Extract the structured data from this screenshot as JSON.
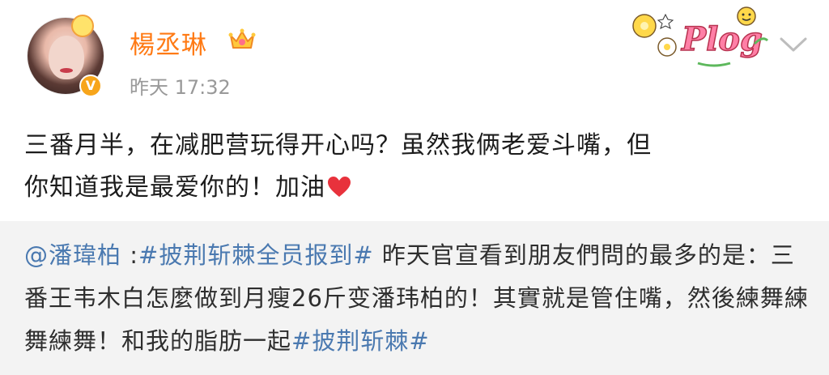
{
  "post": {
    "username": "楊丞琳",
    "timestamp": "昨天 17:32",
    "verified_mark": "V",
    "sticker_text": "Plog",
    "text_line1": "三番月半，在减肥营玩得开心吗？虽然我俩老爱斗嘴，但",
    "text_line2": "你知道我是最爱你的！加油"
  },
  "repost": {
    "mention": "@潘瑋柏",
    "sep": " :",
    "hashtag1": "#披荆斩棘全员报到#",
    "body_part1": " 昨天官宣看到朋友們問的最多的是：三番王韦木白怎麼做到月瘦26斤变潘玮柏的！其實就是管住嘴，然後練舞練舞練舞！和我的脂肪一起",
    "hashtag2": "#披荆斩棘#"
  },
  "colors": {
    "username": "#ff7a14",
    "link": "#4a79b0",
    "repost_bg": "#f3f3f3",
    "timestamp": "#999999",
    "heart": "#e8323c"
  },
  "icons": {
    "verified": "verified-badge-icon",
    "crown": "crown-icon",
    "chevron": "chevron-down-icon",
    "heart": "heart-icon"
  }
}
